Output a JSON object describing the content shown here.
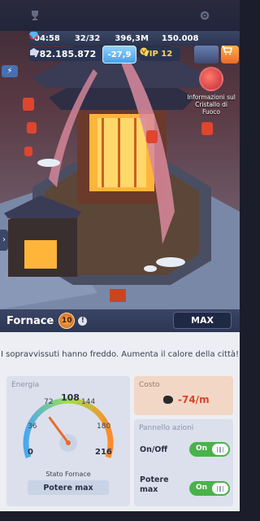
{
  "status_bar": {
    "time": "04:58",
    "survivors": "32/32",
    "coal": "396,3M",
    "gems": "150.008",
    "population": "782.185.872",
    "temperature": "-27,9",
    "vip": "VIP 12"
  },
  "info_button": {
    "label": "Informazioni sul Cristallo di Fuoco"
  },
  "panel": {
    "title": "Fornace",
    "level_badge": "10",
    "max_label": "MAX",
    "notice": "I sopravvissuti hanno freddo. Aumenta il calore della città!"
  },
  "energy": {
    "header": "Energia",
    "ticks": [
      "0",
      "36",
      "72",
      "108",
      "144",
      "180",
      "216"
    ],
    "value": 72,
    "max": 216,
    "status_label": "Stato Fornace",
    "status_value": "Potere max"
  },
  "cost": {
    "header": "Costo",
    "value": "-74/m"
  },
  "actions": {
    "header": "Pannello azioni",
    "items": [
      {
        "label": "On/Off",
        "state": "On"
      },
      {
        "label": "Potere max",
        "state": "On"
      }
    ]
  },
  "icons": [
    "trophy-icon",
    "gear-icon",
    "clock-icon",
    "survivor-icon",
    "coal-icon",
    "gem-icon",
    "population-icon",
    "vip-icon",
    "shop-icon",
    "menu-icon",
    "arrow-icon",
    "fire-crystal-icon"
  ],
  "colors": {
    "accent": "#4a9ee8",
    "toggle_on": "#49b24a",
    "cost": "#d9452c"
  }
}
